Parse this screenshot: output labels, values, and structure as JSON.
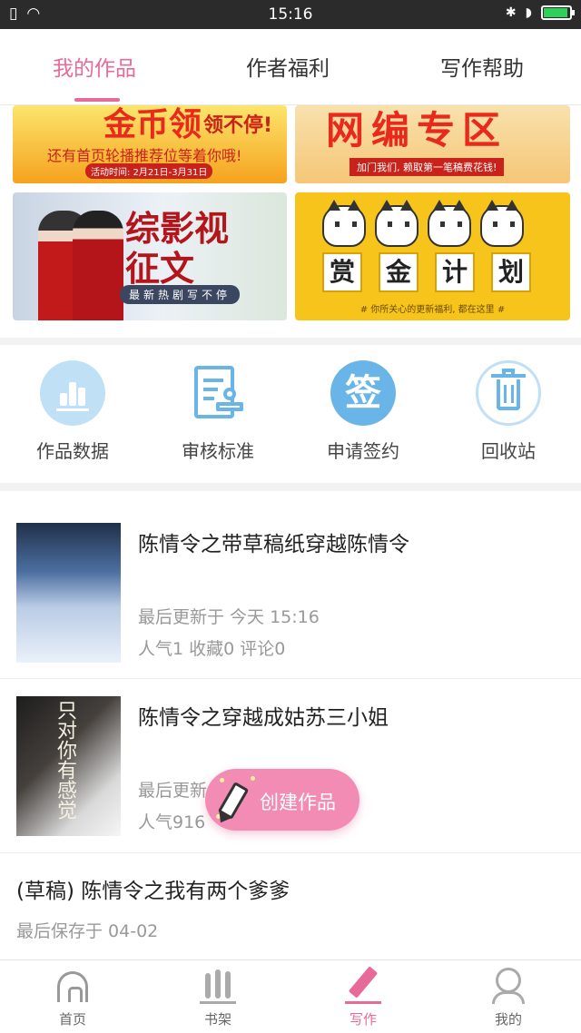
{
  "status_bar": {
    "time": "15:16"
  },
  "tabs": [
    {
      "label": "我的作品",
      "active": true
    },
    {
      "label": "作者福利",
      "active": false
    },
    {
      "label": "写作帮助",
      "active": false
    }
  ],
  "banners": {
    "b1": {
      "big": "金币领",
      "tail": "领不停!",
      "sub": "还有首页轮播推荐位等着你哦!",
      "date": "活动时间: 2月21日-3月31日"
    },
    "b2": {
      "big": "网编专区",
      "sub": "加门我们, 赖取第一笔稿费花钱!"
    },
    "b3": {
      "big": "综影视征文",
      "sub": "最新热剧写不停"
    },
    "b4": {
      "chars": [
        "赏",
        "金",
        "计",
        "划"
      ],
      "foot": "# 你所关心的更新福利, 都在这里 #"
    }
  },
  "quick_actions": [
    {
      "label": "作品数据",
      "icon": "bar-chart-icon"
    },
    {
      "label": "审核标准",
      "icon": "review-stamp-icon"
    },
    {
      "label": "申请签约",
      "icon": "sign-icon",
      "glyph": "签"
    },
    {
      "label": "回收站",
      "icon": "trash-icon"
    }
  ],
  "works": [
    {
      "title": "陈情令之带草稿纸穿越陈情令",
      "updated": "最后更新于 今天 15:16",
      "stats": "人气1  收藏0  评论0"
    },
    {
      "title": "陈情令之穿越成姑苏三小姐",
      "updated": "最后更新",
      "stats": "人气916",
      "cover_text": "只对你有感觉"
    }
  ],
  "draft": {
    "title": "(草稿) 陈情令之我有两个爹爹",
    "saved": "最后保存于 04-02"
  },
  "fab": {
    "label": "创建作品"
  },
  "bottom_nav": [
    {
      "label": "首页",
      "icon": "home-icon",
      "active": false
    },
    {
      "label": "书架",
      "icon": "bookshelf-icon",
      "active": false
    },
    {
      "label": "写作",
      "icon": "pen-icon",
      "active": true
    },
    {
      "label": "我的",
      "icon": "profile-icon",
      "active": false
    }
  ],
  "colors": {
    "accent": "#e86a98",
    "icon_blue": "#6ab5e7",
    "fab": "#f28cb4"
  }
}
